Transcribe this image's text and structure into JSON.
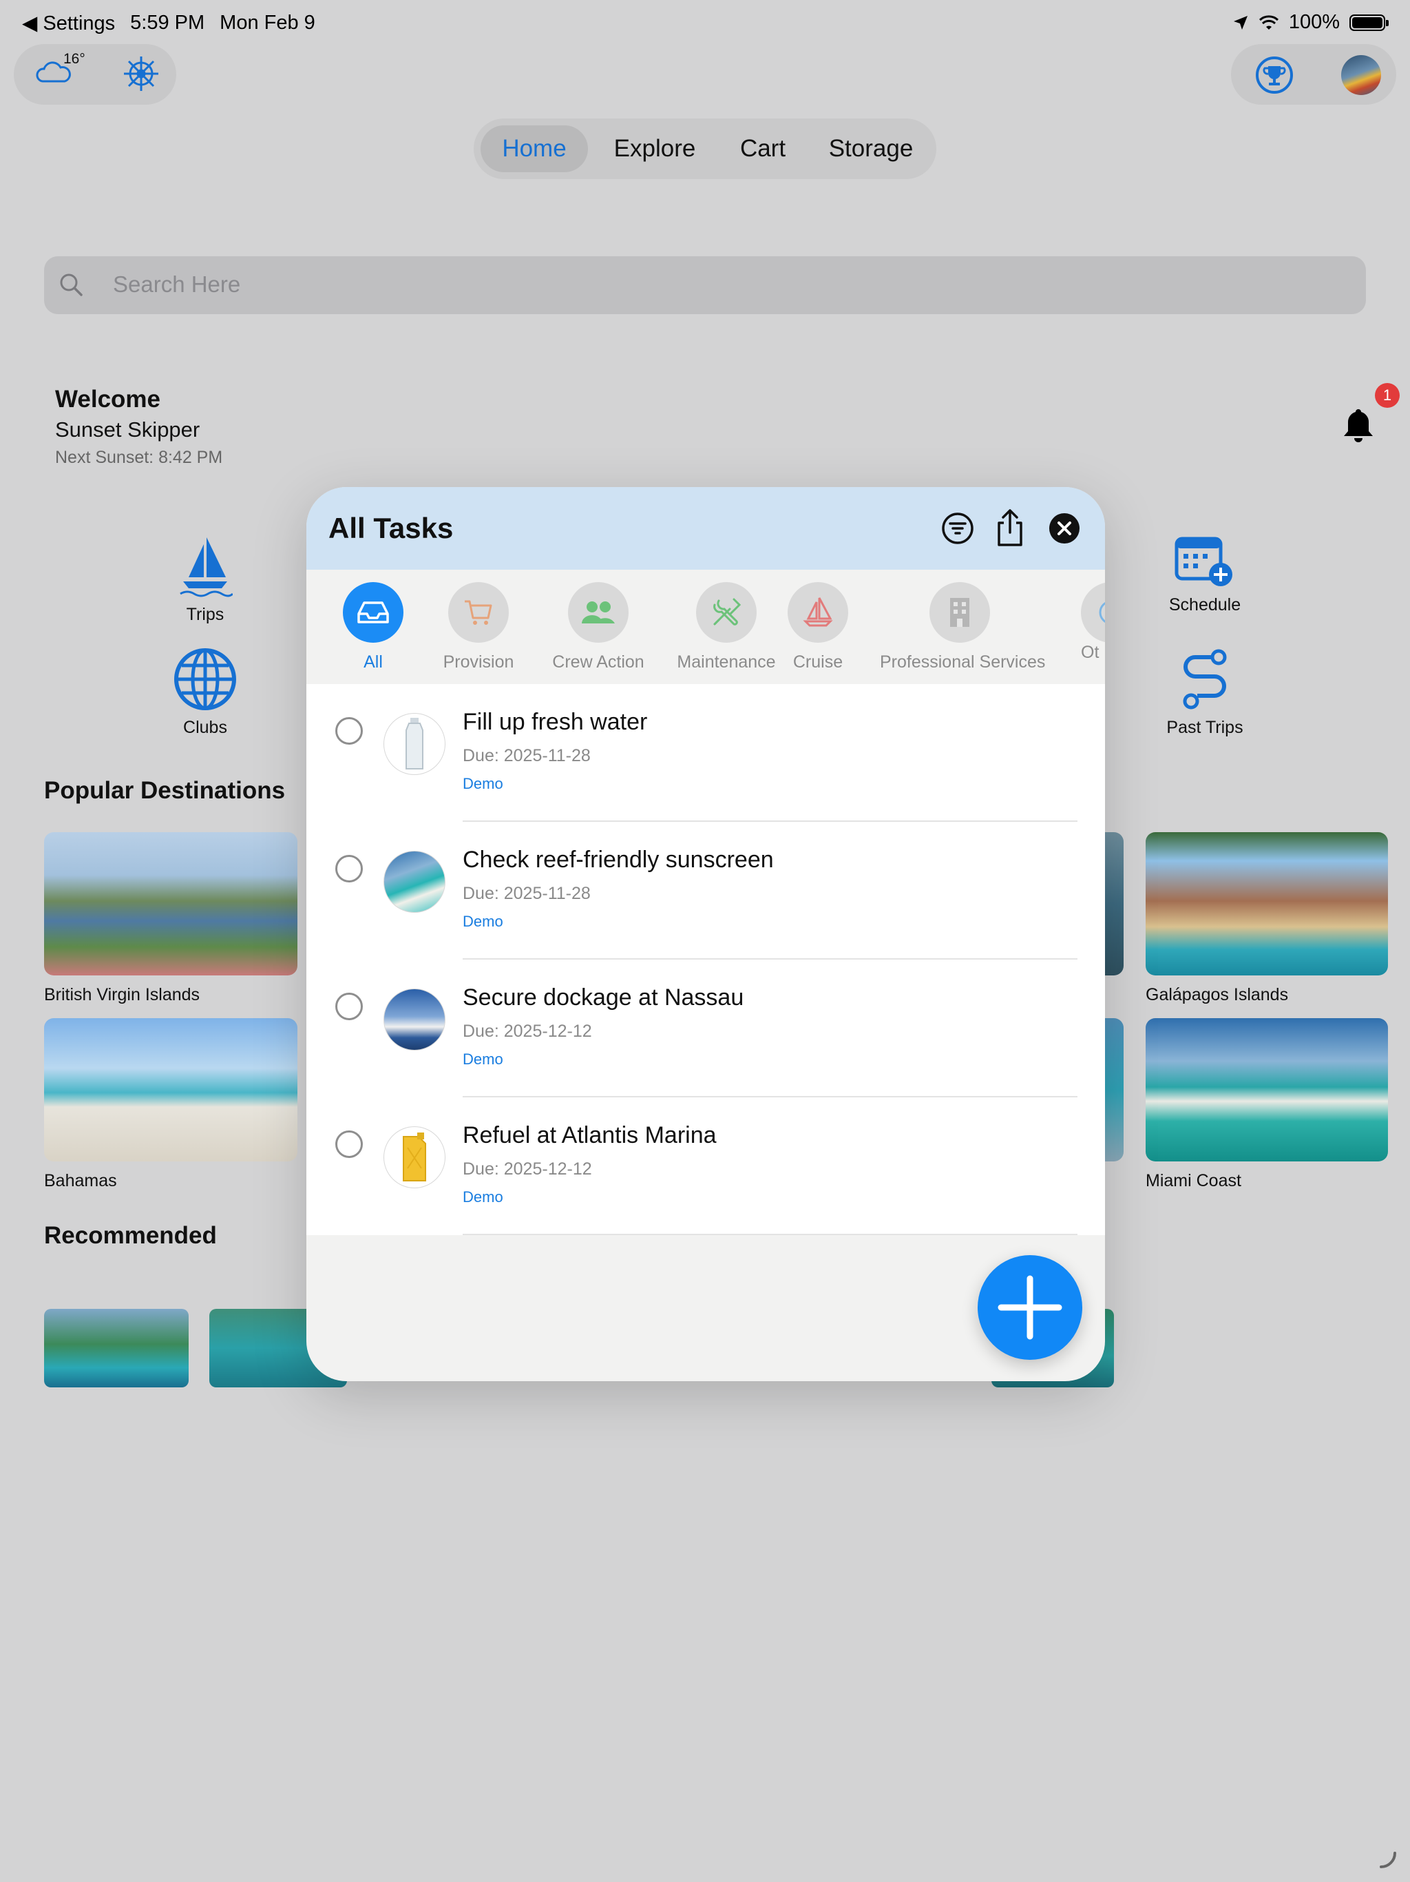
{
  "status_bar": {
    "back_label": "◀ Settings",
    "time": "5:59 PM",
    "date": "Mon Feb 9",
    "battery": "100%"
  },
  "weather": {
    "temperature": "16°"
  },
  "nav_tabs": [
    {
      "label": "Home",
      "active": true
    },
    {
      "label": "Explore",
      "active": false
    },
    {
      "label": "Cart",
      "active": false
    },
    {
      "label": "Storage",
      "active": false
    }
  ],
  "search": {
    "placeholder": "Search Here"
  },
  "welcome": {
    "title": "Welcome",
    "name": "Sunset Skipper",
    "next_sunset": "Next Sunset: 8:42 PM"
  },
  "notifications": {
    "count": "1"
  },
  "quick_actions": {
    "trips": "Trips",
    "clubs": "Clubs",
    "schedule": "Schedule",
    "past_trips": "Past Trips"
  },
  "popular_destinations": {
    "title": "Popular Destinations",
    "items": [
      "British Virgin Islands",
      "Bahamas",
      "Galápagos Islands",
      "Miami Coast"
    ]
  },
  "recommended": {
    "title": "Recommended"
  },
  "modal": {
    "title": "All Tasks",
    "categories": [
      {
        "label": "All",
        "active": true
      },
      {
        "label": "Provision",
        "active": false
      },
      {
        "label": "Crew Action",
        "active": false
      },
      {
        "label": "Maintenance",
        "active": false
      },
      {
        "label": "Cruise",
        "active": false
      },
      {
        "label": "Professional Services",
        "active": false
      },
      {
        "label": "Ot",
        "active": false
      }
    ],
    "tasks": [
      {
        "title": "Fill up fresh water",
        "due": "Due: 2025-11-28",
        "tag": "Demo"
      },
      {
        "title": "Check reef-friendly sunscreen",
        "due": "Due: 2025-11-28",
        "tag": "Demo"
      },
      {
        "title": "Secure dockage at Nassau",
        "due": "Due: 2025-12-12",
        "tag": "Demo"
      },
      {
        "title": "Refuel at Atlantis Marina",
        "due": "Due: 2025-12-12",
        "tag": "Demo"
      }
    ]
  },
  "colors": {
    "accent": "#1188f6",
    "header_bg": "#cfe2f3",
    "icon_blue": "#1670d2",
    "badge_red": "#e23b3b"
  }
}
